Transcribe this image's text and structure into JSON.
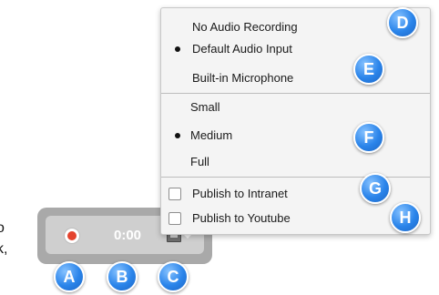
{
  "left_text": {
    "line1": "o",
    "line2": "k,"
  },
  "recorder": {
    "timer": "0:00"
  },
  "menu": {
    "audio": [
      {
        "label": "No Audio Recording",
        "selected": false
      },
      {
        "label": "Default Audio Input",
        "selected": true
      },
      {
        "label": "Built-in Microphone",
        "selected": false
      }
    ],
    "size": [
      {
        "label": "Small",
        "selected": false
      },
      {
        "label": "Medium",
        "selected": true
      },
      {
        "label": "Full",
        "selected": false
      }
    ],
    "publish": [
      {
        "label": "Publish to Intranet",
        "checked": false
      },
      {
        "label": "Publish to Youtube",
        "checked": false
      }
    ]
  },
  "badges": {
    "a": "A",
    "b": "B",
    "c": "C",
    "d": "D",
    "e": "E",
    "f": "F",
    "g": "G",
    "h": "H"
  },
  "colors": {
    "record": "#e4432e",
    "badge": "#2a84ea"
  }
}
